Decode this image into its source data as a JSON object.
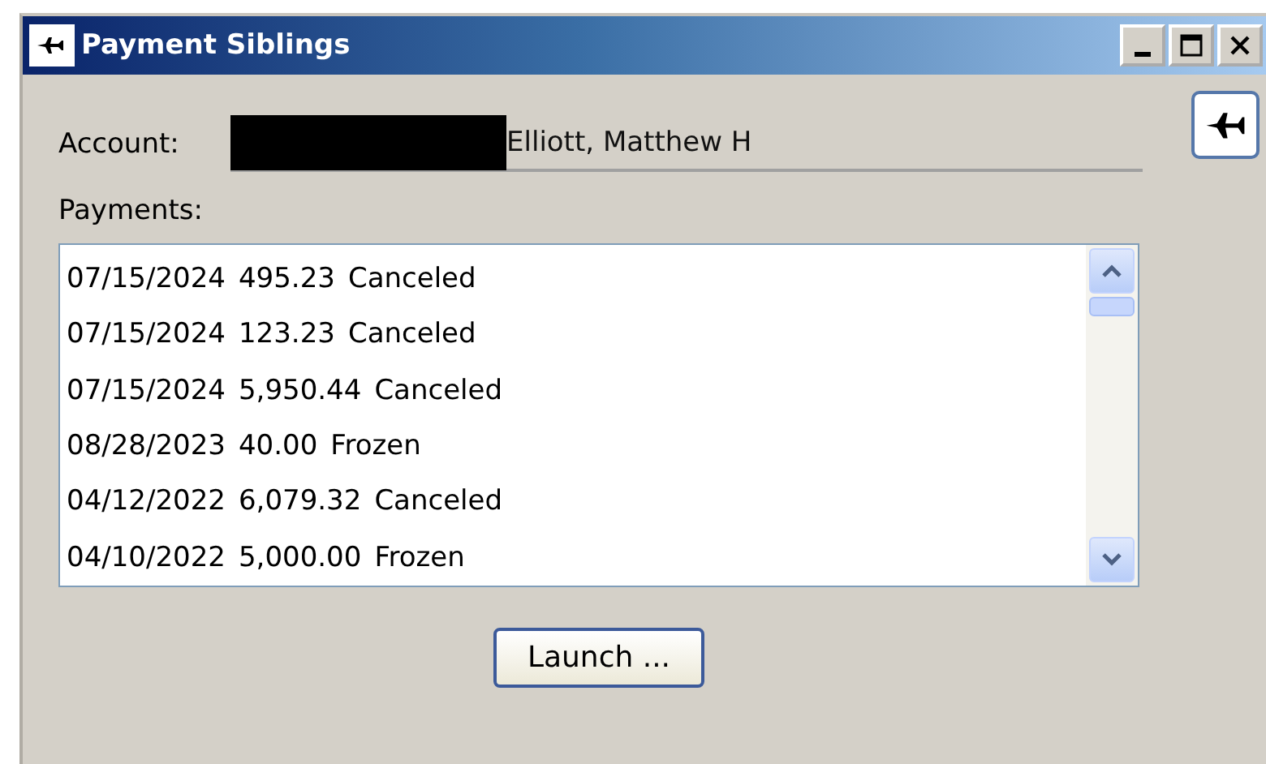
{
  "window": {
    "title": "Payment Siblings"
  },
  "account": {
    "label": "Account:",
    "redacted": true,
    "value": "Elliott, Matthew H"
  },
  "payments": {
    "label": "Payments:",
    "rows": [
      {
        "date": "07/15/2024",
        "amount": "495.23",
        "status": "Canceled"
      },
      {
        "date": "07/15/2024",
        "amount": "123.23",
        "status": "Canceled"
      },
      {
        "date": "07/15/2024",
        "amount": "5,950.44",
        "status": "Canceled"
      },
      {
        "date": "08/28/2023",
        "amount": "40.00",
        "status": "Frozen"
      },
      {
        "date": "04/12/2022",
        "amount": "6,079.32",
        "status": "Canceled"
      },
      {
        "date": "04/10/2022",
        "amount": "5,000.00",
        "status": "Frozen"
      }
    ]
  },
  "buttons": [
    "Launch ..."
  ]
}
